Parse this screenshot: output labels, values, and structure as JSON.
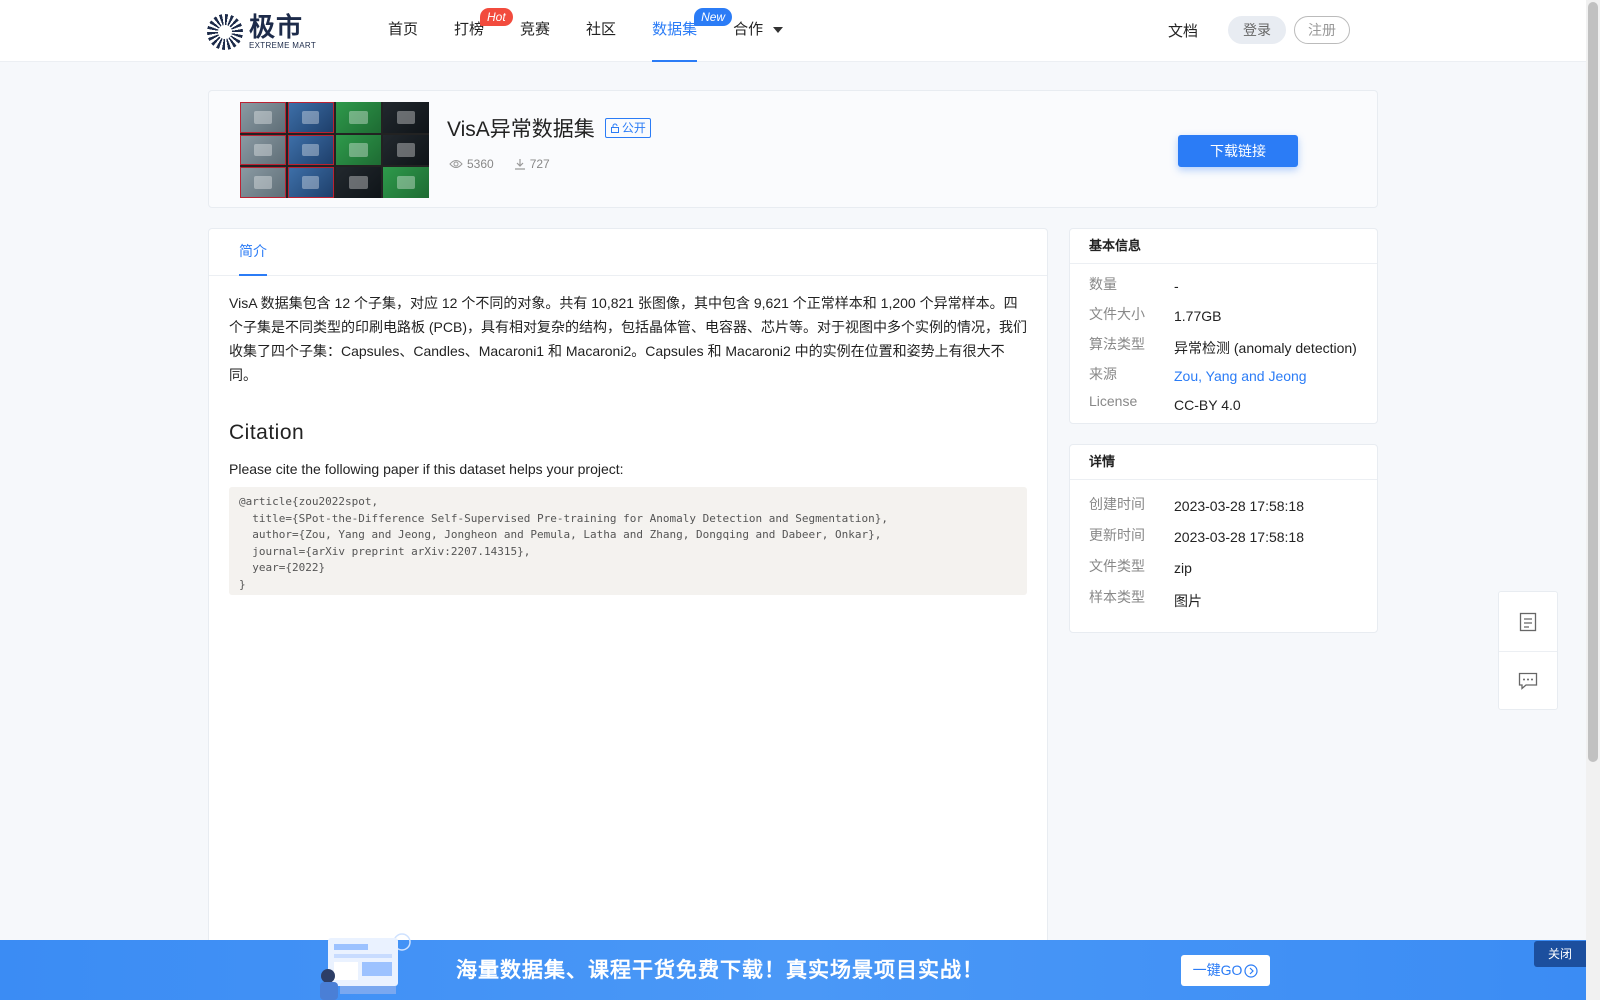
{
  "header": {
    "logo_cn": "极市",
    "logo_en": "EXTREME MART",
    "nav": [
      {
        "label": "首页"
      },
      {
        "label": "打榜",
        "badge": "Hot"
      },
      {
        "label": "竞赛"
      },
      {
        "label": "社区"
      },
      {
        "label": "数据集",
        "badge": "New",
        "active": true
      },
      {
        "label": "合作",
        "dropdown": true
      }
    ],
    "docs": "文档",
    "login": "登录",
    "register": "注册"
  },
  "dataset": {
    "title": "VisA异常数据集",
    "visibility": "公开",
    "views": "5360",
    "downloads": "727",
    "download_button": "下载链接"
  },
  "tabs": {
    "intro": "简介"
  },
  "intro_text": "VisA 数据集包含 12 个子集，对应 12 个不同的对象。共有 10,821 张图像，其中包含 9,621 个正常样本和 1,200 个异常样本。四个子集是不同类型的印刷电路板 (PCB)，具有相对复杂的结构，包括晶体管、电容器、芯片等。对于视图中多个实例的情况，我们收集了四个子集：Capsules、Candles、Macaroni1 和 Macaroni2。Capsules 和 Macaroni2 中的实例在位置和姿势上有很大不同。",
  "citation": {
    "heading": "Citation",
    "description": "Please cite the following paper if this dataset helps your project:",
    "bibtex": "@article{zou2022spot,\n  title={SPot-the-Difference Self-Supervised Pre-training for Anomaly Detection and Segmentation},\n  author={Zou, Yang and Jeong, Jongheon and Pemula, Latha and Zhang, Dongqing and Dabeer, Onkar},\n  journal={arXiv preprint arXiv:2207.14315},\n  year={2022}\n}"
  },
  "basic_info": {
    "heading": "基本信息",
    "rows": [
      {
        "label": "数量",
        "value": "-"
      },
      {
        "label": "文件大小",
        "value": "1.77GB"
      },
      {
        "label": "算法类型",
        "value": "异常检测 (anomaly detection)"
      },
      {
        "label": "来源",
        "value": "Zou, Yang and Jeong"
      },
      {
        "label": "License",
        "value": "CC-BY 4.0"
      }
    ]
  },
  "details": {
    "heading": "详情",
    "rows": [
      {
        "label": "创建时间",
        "value": "2023-03-28 17:58:18"
      },
      {
        "label": "更新时间",
        "value": "2023-03-28 17:58:18"
      },
      {
        "label": "文件类型",
        "value": "zip"
      },
      {
        "label": "样本类型",
        "value": "图片"
      }
    ]
  },
  "banner": {
    "text": "海量数据集、课程干货免费下载！真实场景项目实战！",
    "button": "一键GO",
    "close": "关闭"
  },
  "colors": {
    "accent": "#2b7cf6",
    "hot_badge": "#f24b3d",
    "banner_bg": "#3b8cf4"
  }
}
